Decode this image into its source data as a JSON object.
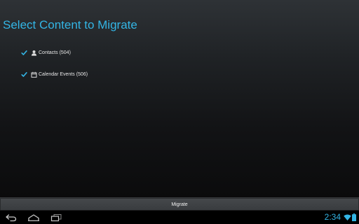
{
  "page": {
    "title": "Select Content to Migrate"
  },
  "items": [
    {
      "label": "Contacts (504)",
      "checked": true,
      "icon": "contacts-icon"
    },
    {
      "label": "Calendar Events (506)",
      "checked": true,
      "icon": "calendar-icon"
    }
  ],
  "actions": {
    "migrate_label": "Migrate"
  },
  "status_bar": {
    "time": "2:34",
    "wifi_icon": "wifi-icon",
    "battery_icon": "battery-icon"
  },
  "nav_bar": {
    "back_icon": "back-icon",
    "home_icon": "home-icon",
    "recent_icon": "recent-apps-icon"
  },
  "colors": {
    "accent": "#33b5e5",
    "text": "#e6e6e6",
    "button_bg": "#3f4245"
  }
}
